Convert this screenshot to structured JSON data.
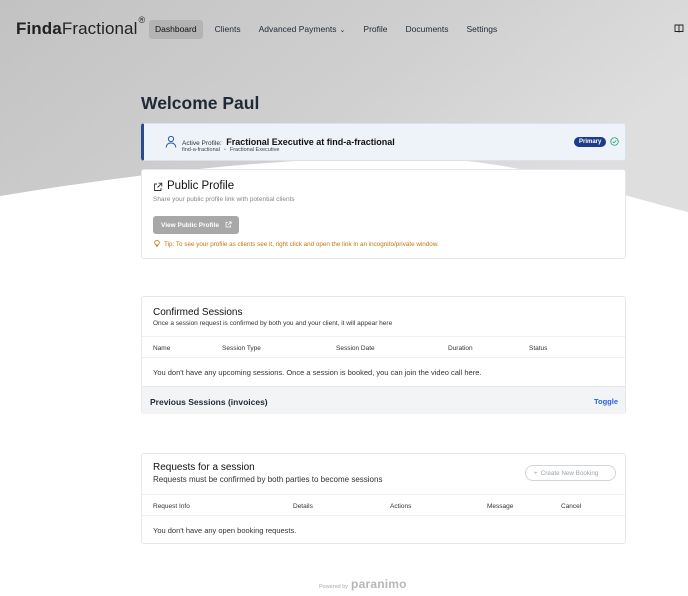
{
  "brand": {
    "logo_bold": "Finda",
    "logo_light": "Fractional",
    "logo_mark": "®"
  },
  "nav": {
    "items": [
      {
        "label": "Dashboard",
        "active": true
      },
      {
        "label": "Clients"
      },
      {
        "label": "Advanced Payments",
        "has_dropdown": true
      },
      {
        "label": "Profile"
      },
      {
        "label": "Documents"
      },
      {
        "label": "Settings"
      }
    ],
    "chevron": "⌄",
    "right_icon": "book-icon"
  },
  "welcome": "Welcome Paul",
  "active_profile": {
    "prefix": "Active Profile:",
    "title": "Fractional Executive at find-a-fractional",
    "handle": "find-a-fractional",
    "separator": "•",
    "role": "Fractional Executive",
    "badge": "Primary",
    "accent_color": "#2b4c8c",
    "badge_color": "#1e3a8a"
  },
  "public_profile": {
    "title": "Public Profile",
    "subtitle": "Share your public profile link with potential clients",
    "button": "View Public Profile",
    "tip": "Tip: To see your profile as clients see it, right click and open the link in an incognito/private window.",
    "tip_color": "#c2770e"
  },
  "confirmed_sessions": {
    "title": "Confirmed Sessions",
    "subtitle": "Once a session request is confirmed by both you and your client, it will appear here",
    "columns": [
      "Name",
      "Session Type",
      "Session Date",
      "Duration",
      "Status"
    ],
    "empty_message": "You don't have any upcoming sessions. Once a session is booked, you can join the video call here.",
    "previous_label": "Previous Sessions (invoices)",
    "toggle_label": "Toggle",
    "link_color": "#2563eb"
  },
  "requests": {
    "title": "Requests for a session",
    "subtitle": "Requests must be confirmed by both parties to become sessions",
    "button": "Create New Booking",
    "columns": [
      "Request Info",
      "Details",
      "Actions",
      "Message",
      "Cancel"
    ],
    "empty_message": "You don't have any open booking requests."
  },
  "footer": {
    "powered_by": "Powered by",
    "brand": "paranimo"
  }
}
